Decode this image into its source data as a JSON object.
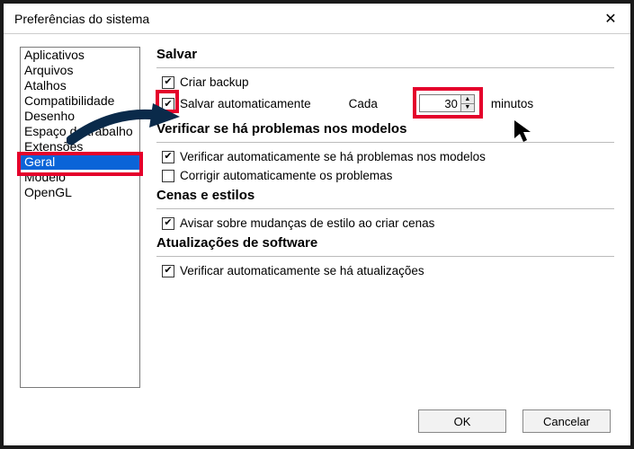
{
  "window": {
    "title": "Preferências do sistema",
    "close_glyph": "✕"
  },
  "sidebar": {
    "items": [
      {
        "label": "Aplicativos"
      },
      {
        "label": "Arquivos"
      },
      {
        "label": "Atalhos"
      },
      {
        "label": "Compatibilidade"
      },
      {
        "label": "Desenho"
      },
      {
        "label": "Espaço de trabalho"
      },
      {
        "label": "Extensões"
      },
      {
        "label": "Geral",
        "selected": true
      },
      {
        "label": "Modelo"
      },
      {
        "label": "OpenGL"
      }
    ]
  },
  "sections": {
    "save": {
      "title": "Salvar",
      "backup": {
        "label": "Criar backup",
        "checked": true
      },
      "autosave": {
        "label": "Salvar automaticamente",
        "checked": true,
        "each_label": "Cada",
        "value": "30",
        "unit": "minutos"
      }
    },
    "verify": {
      "title": "Verificar se há problemas nos modelos",
      "auto_check": {
        "label": "Verificar automaticamente se há problemas nos modelos",
        "checked": true
      },
      "auto_fix": {
        "label": "Corrigir automaticamente os problemas",
        "checked": false
      }
    },
    "scenes": {
      "title": "Cenas e estilos",
      "warn": {
        "label": "Avisar sobre mudanças de estilo ao criar cenas",
        "checked": true
      }
    },
    "updates": {
      "title": "Atualizações de software",
      "auto": {
        "label": "Verificar automaticamente se há atualizações",
        "checked": true
      }
    }
  },
  "buttons": {
    "ok": "OK",
    "cancel": "Cancelar"
  },
  "highlight_color": "#e4002b"
}
